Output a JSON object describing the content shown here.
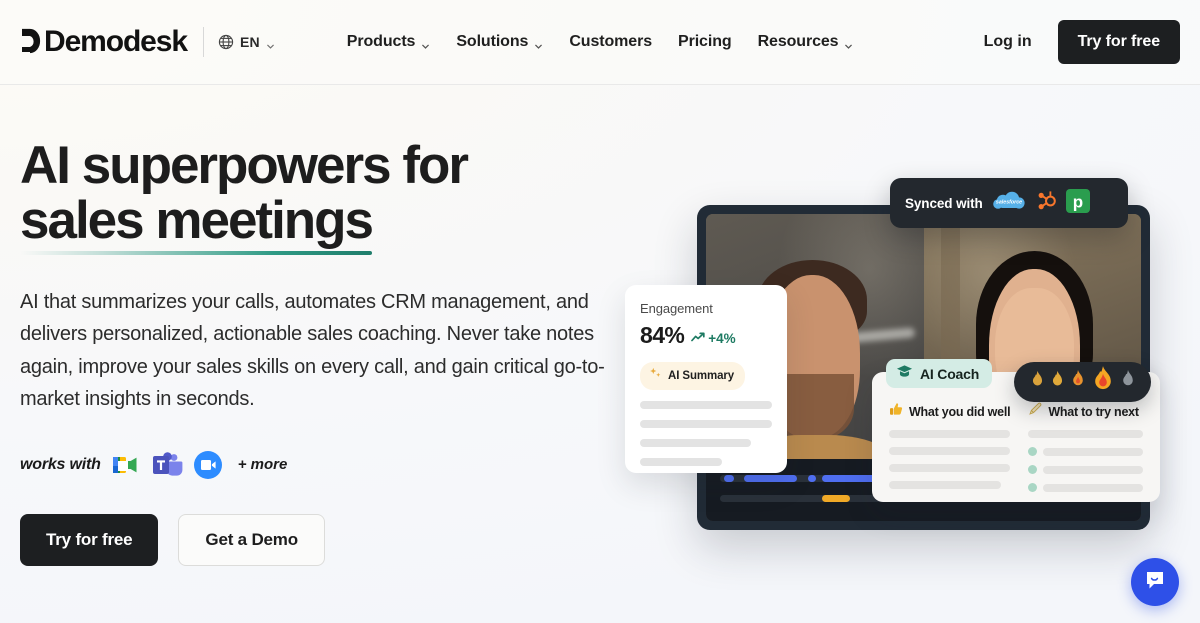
{
  "header": {
    "logo_text": "Demodesk",
    "logo_icon": "demodesk-d-mark",
    "language": {
      "icon": "globe-icon",
      "label": "EN",
      "chevron": "chevron-down-icon"
    },
    "nav": [
      {
        "label": "Products",
        "has_chevron": true
      },
      {
        "label": "Solutions",
        "has_chevron": true
      },
      {
        "label": "Customers",
        "has_chevron": false
      },
      {
        "label": "Pricing",
        "has_chevron": false
      },
      {
        "label": "Resources",
        "has_chevron": true
      }
    ],
    "login_label": "Log in",
    "try_free_label": "Try for free"
  },
  "hero": {
    "headline_line1": "AI superpowers for",
    "headline_line2": "sales meetings",
    "subhead": "AI that summarizes your calls, automates CRM management, and delivers personalized, actionable sales coaching. Never take notes again, improve your sales skills on every call, and gain critical go-to-market insights in seconds.",
    "works_with_label": "works with",
    "works_with_more": "+ more",
    "integrations": [
      {
        "name": "google-meet-icon",
        "label": "Google Meet"
      },
      {
        "name": "microsoft-teams-icon",
        "label": "Microsoft Teams"
      },
      {
        "name": "zoom-icon",
        "label": "Zoom"
      }
    ],
    "cta_primary": "Try for free",
    "cta_secondary": "Get a Demo"
  },
  "visual": {
    "synced": {
      "label": "Synced with",
      "crms": [
        {
          "name": "salesforce-icon",
          "label": "salesforce"
        },
        {
          "name": "hubspot-icon",
          "label": "HubSpot"
        },
        {
          "name": "pipedrive-icon",
          "label": "Pipedrive"
        }
      ]
    },
    "engagement": {
      "title": "Engagement",
      "value": "84%",
      "delta": "+4%",
      "delta_icon": "trend-up-icon",
      "badge_icon": "sparkle-icon",
      "badge_label": "AI Summary",
      "skeleton_widths": [
        100,
        100,
        84,
        62
      ]
    },
    "coach": {
      "tab_icon": "graduation-cap-icon",
      "tab_label": "AI Coach",
      "columns": [
        {
          "icon": "thumbs-up-icon",
          "title": "What you did well",
          "lines": 4,
          "bulleted": false
        },
        {
          "icon": "pencil-icon",
          "title": "What to try next",
          "lines": 4,
          "bulleted": true
        }
      ]
    },
    "flames": {
      "lit": 4,
      "unlit": 1,
      "icon": "flame-icon"
    },
    "waveform": {
      "track_blue": [
        [
          4,
          10
        ],
        [
          18,
          26
        ],
        [
          48,
          4
        ],
        [
          56,
          30
        ],
        [
          92,
          8
        ]
      ],
      "track_orange": [
        [
          36,
          14
        ],
        [
          60,
          8
        ],
        [
          74,
          6
        ]
      ]
    }
  },
  "chat_widget": {
    "icon": "chat-bubble-icon",
    "label": "Open chat"
  },
  "colors": {
    "accent_dark": "#1d1f21",
    "underline": "#2f9a85",
    "chat_blue": "#2e50e8",
    "delta_green": "#1d7a62",
    "badge_cream": "#fdf4e3"
  }
}
